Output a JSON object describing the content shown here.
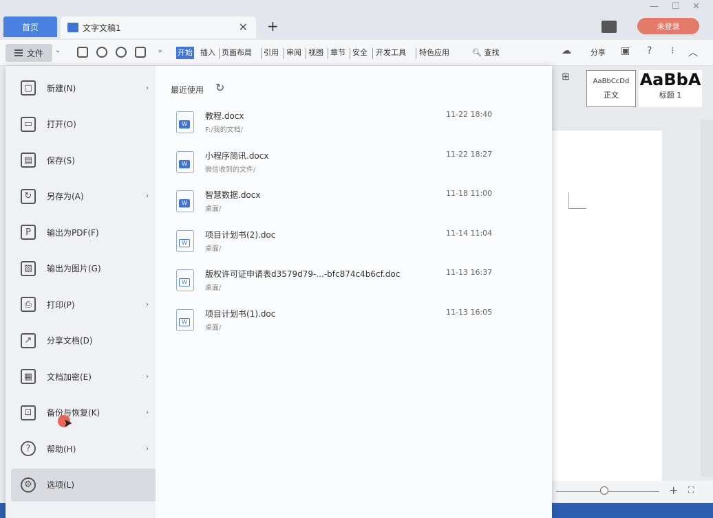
{
  "titlebar": {
    "home_tab": "首页",
    "doc_tab": "文字文稿1",
    "login": "未登录"
  },
  "ribbon": {
    "file_menu": "文件",
    "tabs": [
      "开始",
      "插入",
      "页面布局",
      "引用",
      "审阅",
      "视图",
      "章节",
      "安全",
      "开发工具",
      "特色应用"
    ],
    "active_tab": "开始",
    "search": "查找",
    "share": "分享"
  },
  "styles": {
    "normal_preview": "AaBbCcDd",
    "normal_label": "正文",
    "heading_preview": "AaBbA",
    "heading_label": "标题 1"
  },
  "file_menu": {
    "items": [
      {
        "label": "新建(N)",
        "icon": "new-doc-icon",
        "has_submenu": true
      },
      {
        "label": "打开(O)",
        "icon": "folder-icon",
        "has_submenu": false
      },
      {
        "label": "保存(S)",
        "icon": "save-icon",
        "has_submenu": false
      },
      {
        "label": "另存为(A)",
        "icon": "save-as-icon",
        "has_submenu": true
      },
      {
        "label": "输出为PDF(F)",
        "icon": "pdf-icon",
        "has_submenu": false
      },
      {
        "label": "输出为图片(G)",
        "icon": "image-icon",
        "has_submenu": false
      },
      {
        "label": "打印(P)",
        "icon": "print-icon",
        "has_submenu": true
      },
      {
        "label": "分享文档(D)",
        "icon": "share-icon",
        "has_submenu": false
      },
      {
        "label": "文档加密(E)",
        "icon": "encrypt-icon",
        "has_submenu": true
      },
      {
        "label": "备份与恢复(K)",
        "icon": "backup-icon",
        "has_submenu": true
      },
      {
        "label": "帮助(H)",
        "icon": "help-icon",
        "has_submenu": true
      },
      {
        "label": "选项(L)",
        "icon": "gear-icon",
        "has_submenu": false
      }
    ],
    "selected_index": 11
  },
  "recent": {
    "title": "最近使用",
    "files": [
      {
        "name": "教程.docx",
        "path": "F:/我的文档/",
        "time": "11-22 18:40",
        "type": "docx"
      },
      {
        "name": "小程序简讯.docx",
        "path": "微信收到的文件/",
        "time": "11-22 18:27",
        "type": "docx"
      },
      {
        "name": "智慧数据.docx",
        "path": "桌面/",
        "time": "11-18 11:00",
        "type": "docx"
      },
      {
        "name": "项目计划书(2).doc",
        "path": "桌面/",
        "time": "11-14 11:04",
        "type": "doc"
      },
      {
        "name": "版权许可证申请表d3579d79-...-bfc874c4b6cf.doc",
        "path": "桌面/",
        "time": "11-13 16:37",
        "type": "doc"
      },
      {
        "name": "项目计划书(1).doc",
        "path": "桌面/",
        "time": "11-13 16:05",
        "type": "doc"
      }
    ]
  },
  "colors": {
    "accent": "#3f74d6",
    "login": "#e37a6a",
    "cursor": "#e9554a"
  }
}
